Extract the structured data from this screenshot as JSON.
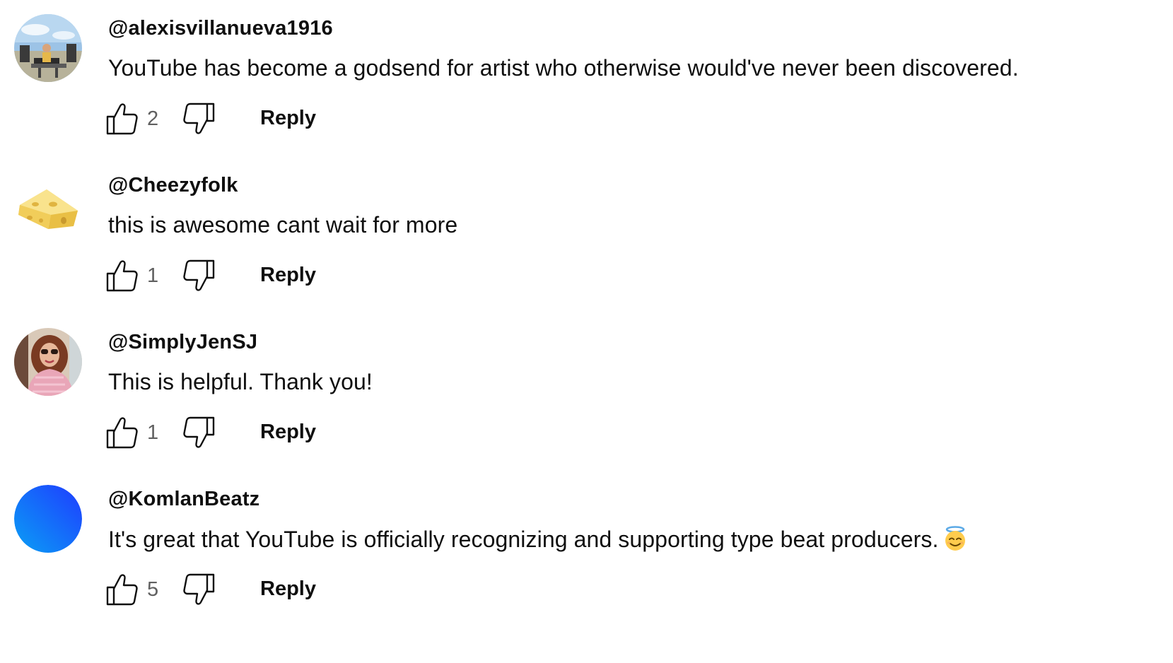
{
  "comments": [
    {
      "author": "@alexisvillanueva1916",
      "text": "YouTube has become a godsend for artist who otherwise would've never been discovered.",
      "likes": "2",
      "reply_label": "Reply",
      "avatar": "photo-outdoor-band-stage",
      "has_emoji": false
    },
    {
      "author": "@Cheezyfolk",
      "text": "this is awesome cant wait for more",
      "likes": "1",
      "reply_label": "Reply",
      "avatar": "cheese-wedge",
      "has_emoji": false
    },
    {
      "author": "@SimplyJenSJ",
      "text": "This is helpful. Thank you!",
      "likes": "1",
      "reply_label": "Reply",
      "avatar": "photo-woman-sunglasses",
      "has_emoji": false
    },
    {
      "author": "@KomlanBeatz",
      "text": "It's great that YouTube is officially recognizing and supporting type beat producers.",
      "likes": "5",
      "reply_label": "Reply",
      "avatar": "blue-gradient-circle",
      "has_emoji": true,
      "emoji": "smiling-face-with-halo"
    }
  ],
  "icons": {
    "like": "thumbs-up-outline-icon",
    "dislike": "thumbs-down-outline-icon"
  },
  "colors": {
    "text": "#0f0f0f",
    "secondary_text": "#606060",
    "background": "#ffffff"
  }
}
